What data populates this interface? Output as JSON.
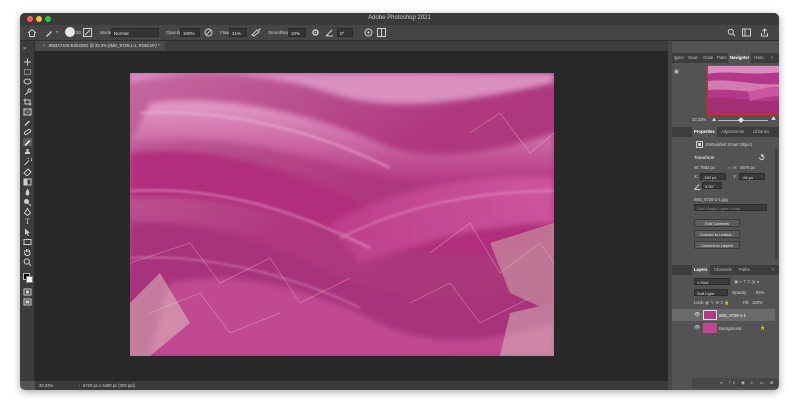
{
  "app": {
    "title": "Adobe Photoshop 2021"
  },
  "options_bar": {
    "mode_label": "Mode:",
    "mode_value": "Normal",
    "brush_size": "30",
    "opacity_label": "Opacity:",
    "opacity_value": "100%",
    "flow_label": "Flow:",
    "flow_value": "31%",
    "smoothing_label": "Smoothing:",
    "smoothing_value": "10%",
    "angle_value": "0°"
  },
  "document": {
    "tab_title": "8W3A7443-Edit.DNG @ 33.3% (IMG_9726-1-1, RGB/16*) *"
  },
  "status": {
    "zoom": "33.33%",
    "dimensions": "6720 px x 4480 px (300 ppi)"
  },
  "navigator": {
    "tabs": [
      "Color",
      "Swat",
      "Gradi",
      "Patte",
      "Navigator",
      "Histo"
    ],
    "active_tab": "Navigator",
    "zoom": "33.33%",
    "zoom_level": 0.45
  },
  "properties": {
    "tabs": [
      "Properties",
      "Adjustments",
      "Libraries"
    ],
    "active_tab": "Properties",
    "object_type": "Embedded Smart Object",
    "transform_label": "Transform",
    "w_label": "W:",
    "w_value": "7583 px",
    "h_label": "H:",
    "h_value": "4679 px",
    "x_label": "X:",
    "x_value": "-180 px",
    "y_label": "Y:",
    "y_value": "-94 px",
    "angle_value": "0.00°",
    "filename": "IMG_9726-1-1.jpg",
    "layer_comp_placeholder": "Don't Apply Layer Comp",
    "buttons": [
      "Edit Contents",
      "Convert to Linked...",
      "Convert to Layers"
    ]
  },
  "layers": {
    "tabs": [
      "Layers",
      "Channels",
      "Paths"
    ],
    "active_tab": "Layers",
    "filter_value": "Kind",
    "blend_mode": "Soft Light",
    "opacity_label": "Opacity:",
    "opacity_value": "94%",
    "lock_label": "Lock:",
    "fill_label": "Fill:",
    "fill_value": "100%",
    "items": [
      {
        "name": "IMG_9726-1-1",
        "selected": true
      },
      {
        "name": "Background",
        "selected": false
      }
    ]
  },
  "colors": {
    "accent": "#2f6fd6",
    "close": "#ff5f57",
    "minimize": "#febc2e",
    "zoom": "#28c840",
    "photo_main": "#b83a8e"
  }
}
